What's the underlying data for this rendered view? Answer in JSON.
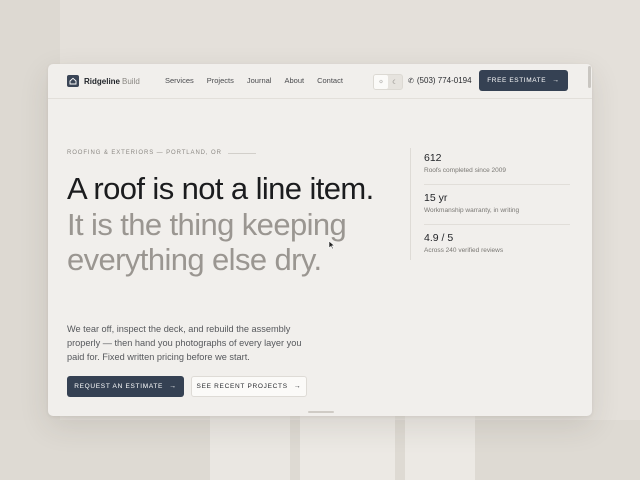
{
  "brand": {
    "name": "Ridgeline",
    "suffix": "Build",
    "icon": "house-icon"
  },
  "nav": [
    "Services",
    "Projects",
    "Journal",
    "About",
    "Contact"
  ],
  "theme_toggle": {
    "light_icon": "sun-icon",
    "dark_icon": "moon-icon",
    "light_glyph": "☼",
    "dark_glyph": "☾"
  },
  "phone": {
    "number": "(503) 774-0194",
    "icon": "phone-icon"
  },
  "cta_top": {
    "label": "FREE ESTIMATE",
    "icon": "arrow-right-icon"
  },
  "hero": {
    "eyebrow": "ROOFING & EXTERIORS — PORTLAND, OR",
    "headline_strong": "A roof is not a line item.",
    "headline_muted": "It is the thing keeping everything else dry.",
    "lead": "We tear off, inspect the deck, and rebuild the assembly properly — then hand you photographs of every layer you paid for. Fixed written pricing before we start.",
    "primary_button": "REQUEST AN ESTIMATE",
    "secondary_button": "SEE RECENT PROJECTS"
  },
  "stats": [
    {
      "value": "612",
      "label": "Roofs completed since 2009"
    },
    {
      "value": "15 yr",
      "label": "Workmanship warranty, in writing"
    },
    {
      "value": "4.9 / 5",
      "label": "Across 240 verified reviews"
    }
  ],
  "colors": {
    "accent": "#354153",
    "background": "#f1efec",
    "muted_text": "#9a9691"
  }
}
